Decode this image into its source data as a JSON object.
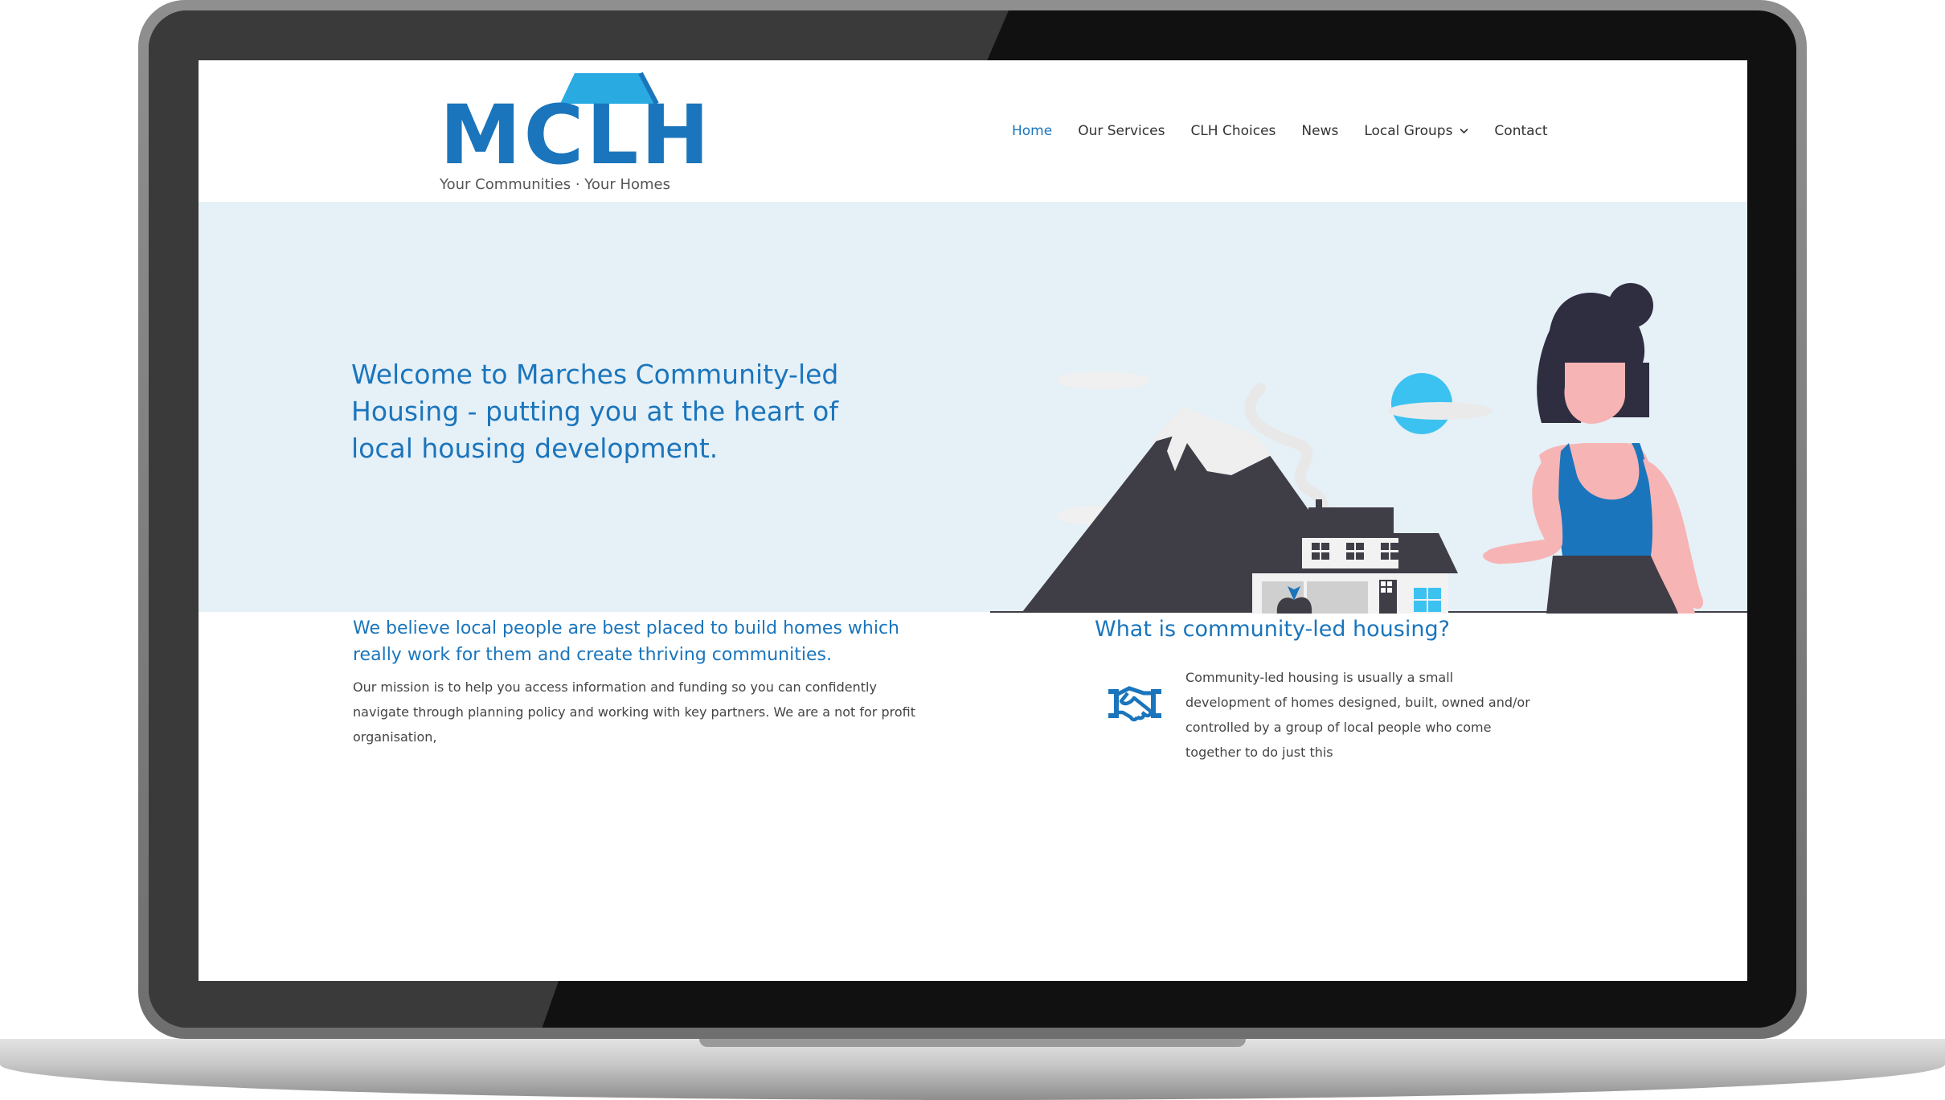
{
  "logo": {
    "mark": "MCLH",
    "tagline": "Your Communities · Your Homes"
  },
  "nav": {
    "items": [
      {
        "label": "Home",
        "active": true
      },
      {
        "label": "Our Services"
      },
      {
        "label": "CLH Choices"
      },
      {
        "label": "News"
      },
      {
        "label": "Local Groups",
        "has_dropdown": true
      },
      {
        "label": "Contact"
      }
    ]
  },
  "hero": {
    "title": "Welcome to Marches Community-led Housing - putting you at the heart of local housing development."
  },
  "intro": {
    "heading": "We believe local people are best placed to build homes which really work for them and create thriving communities.",
    "text": "Our mission is to help you access information and funding so you can confidently navigate through planning policy and working with key partners.  We are a not for profit organisation,"
  },
  "clh": {
    "heading": "What is community-led housing?",
    "text": "Community-led housing is usually a small development of homes designed, built, owned and/or controlled by a group of local people who come together to do just this"
  },
  "icons": {
    "roof": "roof-icon",
    "chevron": "chevron-down-icon",
    "handshake": "handshake-icon"
  },
  "colors": {
    "brand_blue": "#1a75bc",
    "roof_blue": "#29abe2",
    "hero_bg": "#e6f0f7",
    "mountain": "#3f3d46",
    "shirt": "#1a75bc",
    "skin": "#f7b4b4",
    "hair": "#2f2e41"
  }
}
